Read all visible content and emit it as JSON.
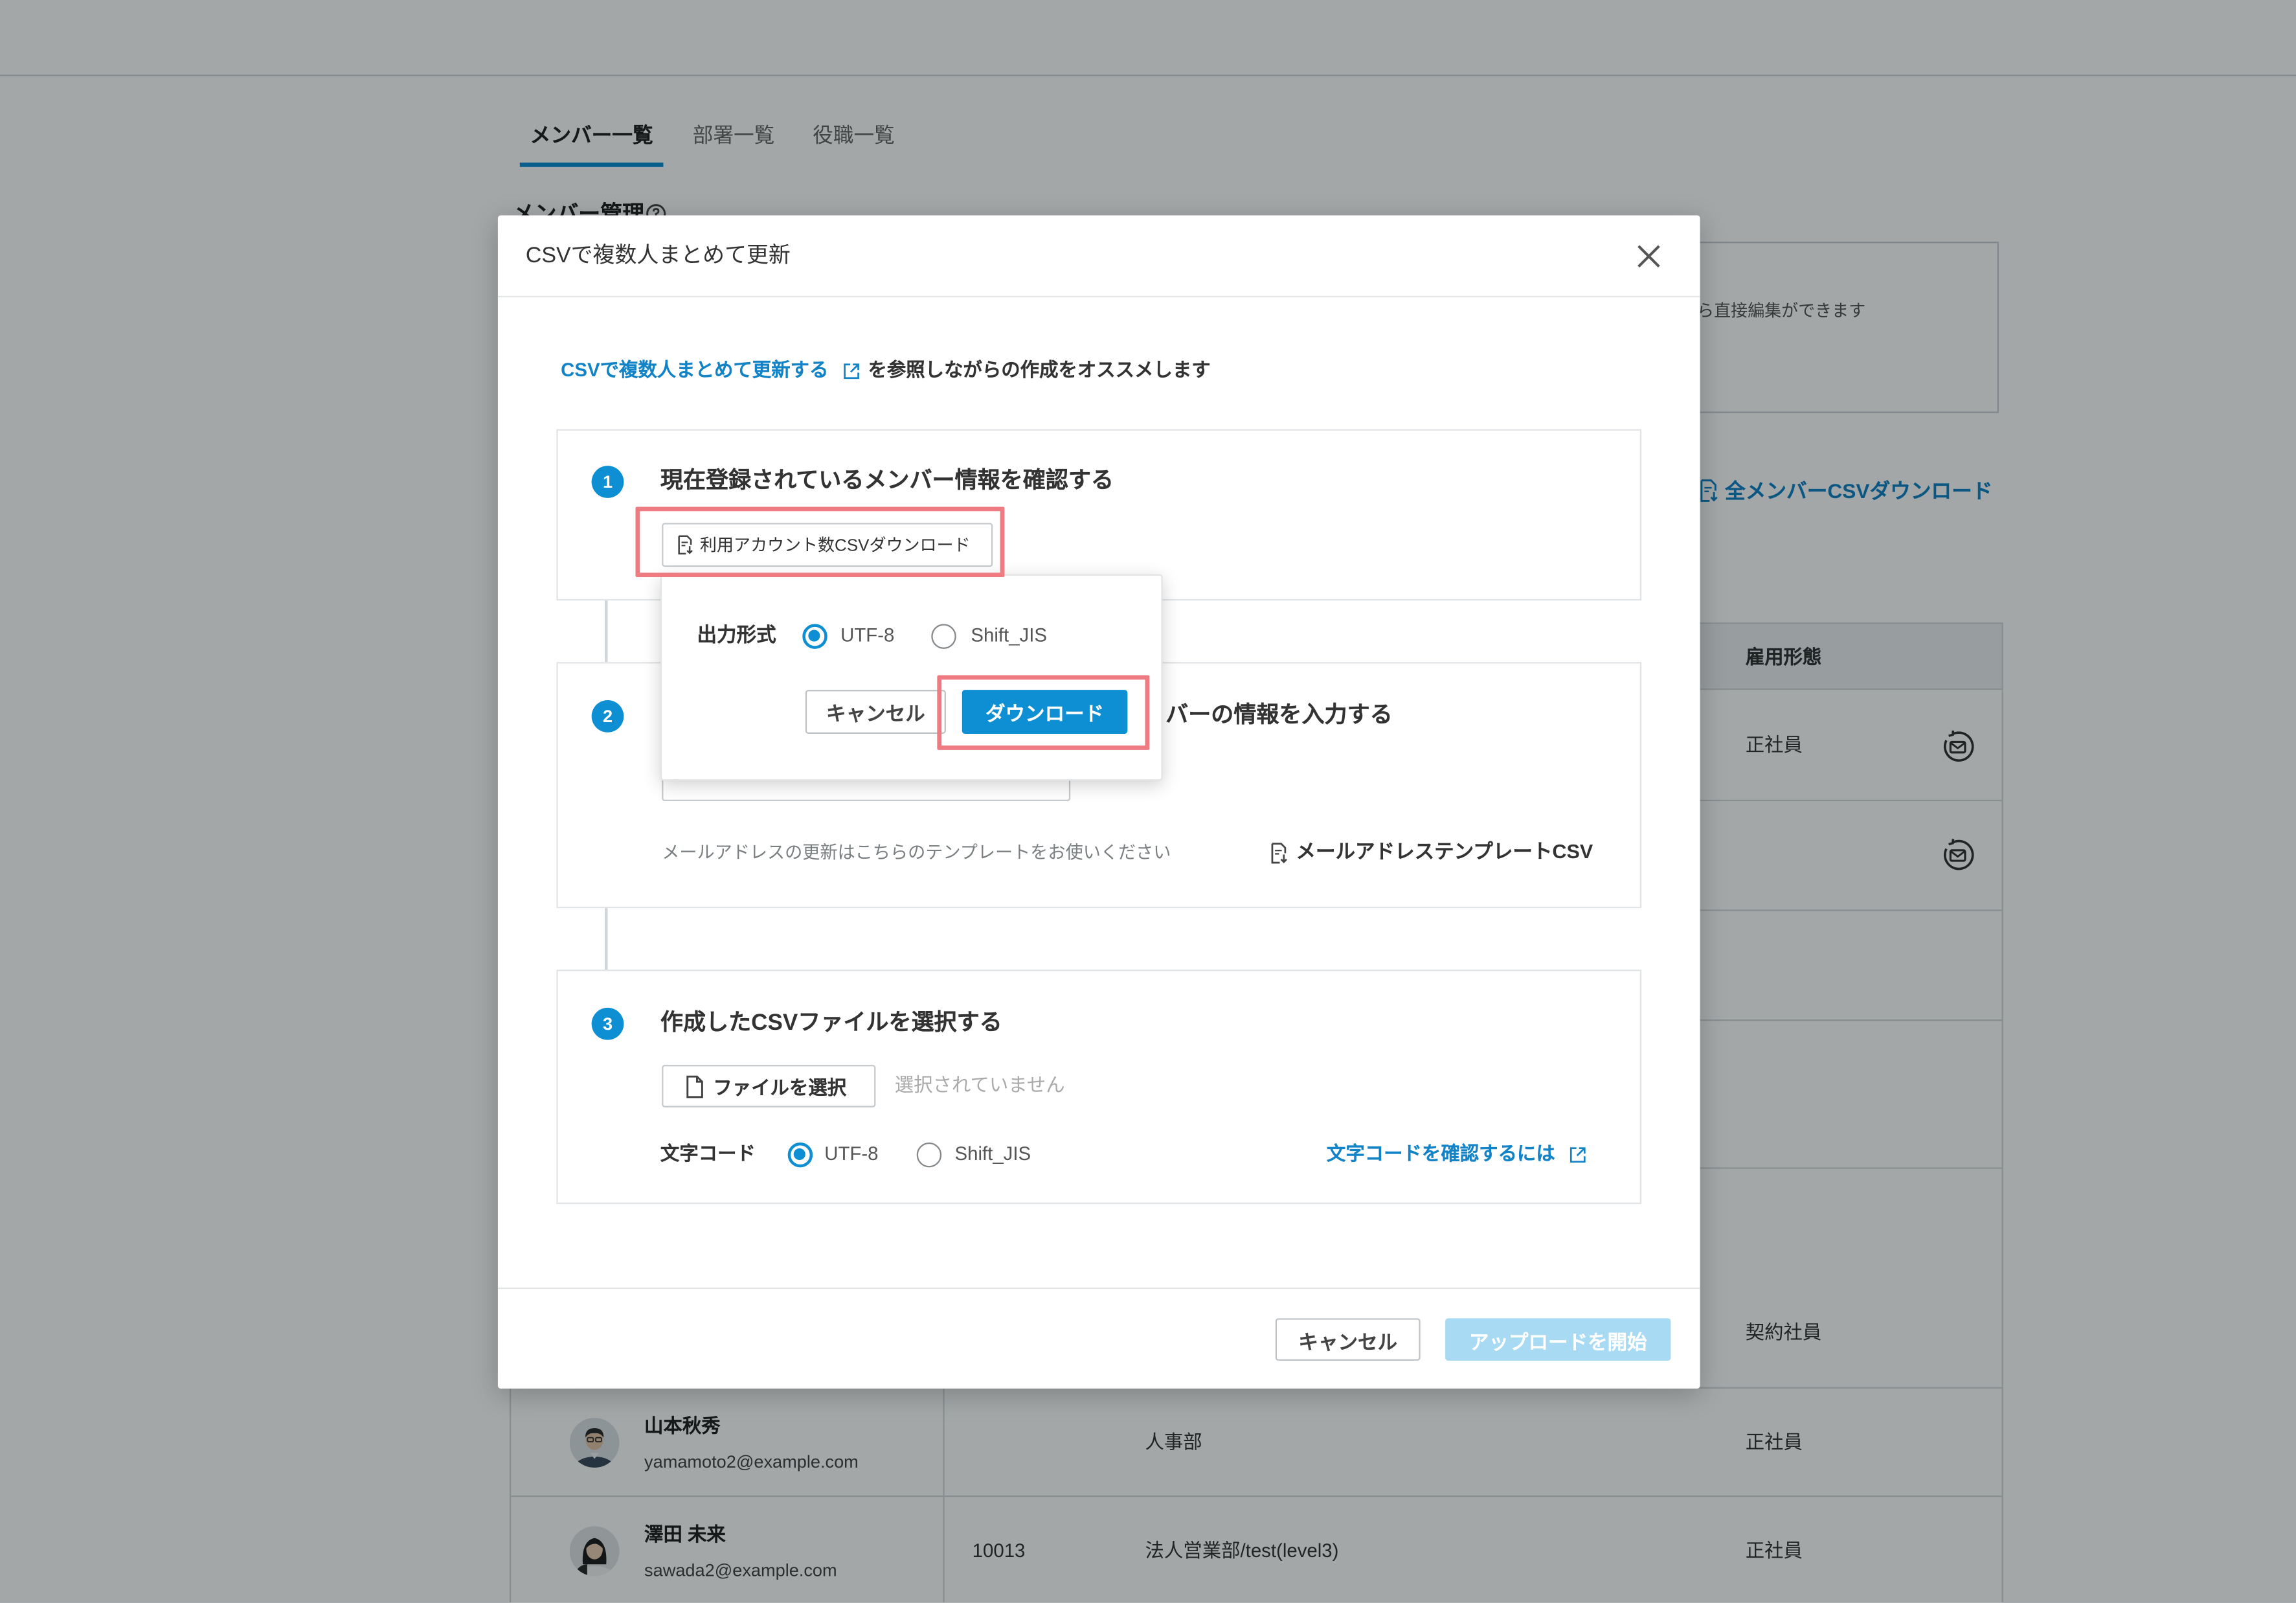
{
  "page": {
    "tabs": [
      {
        "label": "メンバー一覧",
        "active": true
      },
      {
        "label": "部署一覧",
        "active": false
      },
      {
        "label": "役職一覧",
        "active": false
      }
    ],
    "section_title": "メンバー管理",
    "info_box_text": "ら直接編集ができます",
    "download_all_label": "全メンバーCSVダウンロード",
    "table": {
      "header_employment_type": "雇用形態",
      "rows": [
        {
          "employment_type": "正社員",
          "action_icon": "mail-resend-icon"
        },
        {
          "action_icon": "mail-resend-icon"
        },
        {},
        {},
        {
          "employment_type": "契約社員"
        },
        {
          "name": "山本秋秀",
          "email": "yamamoto2@example.com",
          "department": "人事部",
          "employment_type": "正社員"
        },
        {
          "name": "澤田 未来",
          "email": "sawada2@example.com",
          "employee_no": "10013",
          "department": "法人営業部/test(level3)",
          "employment_type": "正社員"
        }
      ]
    }
  },
  "modal": {
    "title": "CSVで複数人まとめて更新",
    "intro": {
      "link_label": "CSVで複数人まとめて更新する",
      "suffix": "を参照しながらの作成をオススメします"
    },
    "steps": [
      {
        "number": "1",
        "title": "現在登録されているメンバー情報を確認する",
        "button_label": "利用アカウント数CSVダウンロード"
      },
      {
        "number": "2",
        "title_visible": "バーの情報を入力する",
        "note": "メールアドレスの更新はこちらのテンプレートをお使いください",
        "template_link": "メールアドレステンプレートCSV"
      },
      {
        "number": "3",
        "title": "作成したCSVファイルを選択する",
        "file_button_label": "ファイルを選択",
        "file_status": "選択されていません",
        "encoding_label": "文字コード",
        "encoding_options": [
          "UTF-8",
          "Shift_JIS"
        ],
        "encoding_selected": "UTF-8",
        "encoding_help_link": "文字コードを確認するには"
      }
    ],
    "footer": {
      "cancel_label": "キャンセル",
      "upload_label": "アップロードを開始",
      "upload_enabled": false
    }
  },
  "download_popover": {
    "format_label": "出力形式",
    "format_options": [
      "UTF-8",
      "Shift_JIS"
    ],
    "format_selected": "UTF-8",
    "cancel_label": "キャンセル",
    "download_label": "ダウンロード"
  },
  "colors": {
    "accent": "#0e8fd4",
    "link": "#1283c6",
    "highlight": "#ee7a82",
    "upload_disabled": "#a8daf3"
  }
}
